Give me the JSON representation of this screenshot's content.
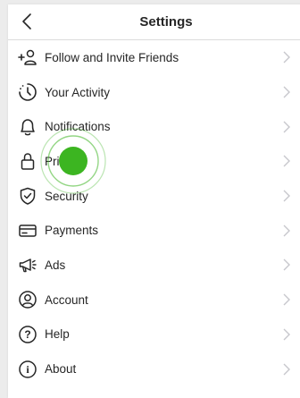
{
  "header": {
    "title": "Settings",
    "back_icon": "chevron-left-icon"
  },
  "menu": [
    {
      "label": "Follow and Invite Friends",
      "icon": "add-person-icon"
    },
    {
      "label": "Your Activity",
      "icon": "activity-clock-icon"
    },
    {
      "label": "Notifications",
      "icon": "bell-icon"
    },
    {
      "label": "Privacy",
      "icon": "lock-icon"
    },
    {
      "label": "Security",
      "icon": "shield-check-icon"
    },
    {
      "label": "Payments",
      "icon": "credit-card-icon"
    },
    {
      "label": "Ads",
      "icon": "megaphone-icon"
    },
    {
      "label": "Account",
      "icon": "account-circle-icon"
    },
    {
      "label": "Help",
      "icon": "help-circle-icon"
    },
    {
      "label": "About",
      "icon": "info-circle-icon"
    }
  ],
  "colors": {
    "tap_indicator": "#3cb521",
    "chevron": "#c7c7cc"
  }
}
